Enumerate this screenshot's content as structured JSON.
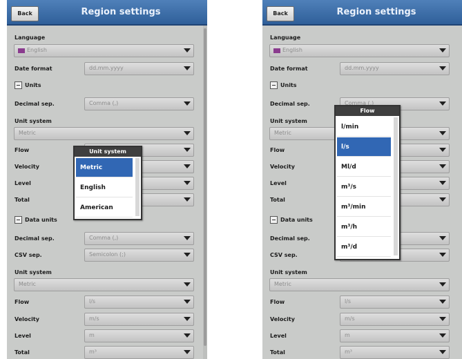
{
  "left": {
    "header": {
      "back_label": "Back",
      "title": "Region settings"
    },
    "language": {
      "label": "Language",
      "value": "English"
    },
    "date_format": {
      "label": "Date format",
      "value": "dd.mm.yyyy"
    },
    "units": {
      "title": "Units",
      "decimal_sep": {
        "label": "Decimal sep.",
        "value": "Comma (,)"
      },
      "unit_system": {
        "label": "Unit system",
        "value": "Metric"
      },
      "flow": {
        "label": "Flow",
        "value": ""
      },
      "velocity": {
        "label": "Velocity",
        "value": ""
      },
      "level": {
        "label": "Level",
        "value": ""
      },
      "total": {
        "label": "Total",
        "value": ""
      }
    },
    "data_units": {
      "title": "Data units",
      "decimal_sep": {
        "label": "Decimal sep.",
        "value": "Comma (,)"
      },
      "csv_sep": {
        "label": "CSV sep.",
        "value": "Semicolon (;)"
      },
      "unit_system": {
        "label": "Unit system",
        "value": "Metric"
      },
      "flow": {
        "label": "Flow",
        "value": "l/s"
      },
      "velocity": {
        "label": "Velocity",
        "value": "m/s"
      },
      "level": {
        "label": "Level",
        "value": "m"
      },
      "total": {
        "label": "Total",
        "value": "m³"
      }
    },
    "popup": {
      "title": "Unit system",
      "options": [
        "Metric",
        "English",
        "American"
      ],
      "selected": "Metric"
    }
  },
  "right": {
    "header": {
      "back_label": "Back",
      "title": "Region settings"
    },
    "language": {
      "label": "Language",
      "value": "English"
    },
    "date_format": {
      "label": "Date format",
      "value": "dd.mm.yyyy"
    },
    "units": {
      "title": "Units",
      "decimal_sep": {
        "label": "Decimal sep.",
        "value": "Comma (,)"
      },
      "unit_system": {
        "label": "Unit system",
        "value": "Metric"
      },
      "flow": {
        "label": "Flow",
        "value": ""
      },
      "velocity": {
        "label": "Velocity",
        "value": ""
      },
      "level": {
        "label": "Level",
        "value": ""
      },
      "total": {
        "label": "Total",
        "value": ""
      }
    },
    "data_units": {
      "title": "Data units",
      "decimal_sep": {
        "label": "Decimal sep.",
        "value": ""
      },
      "csv_sep": {
        "label": "CSV sep.",
        "value": ""
      },
      "unit_system": {
        "label": "Unit system",
        "value": "Metric"
      },
      "flow": {
        "label": "Flow",
        "value": "l/s"
      },
      "velocity": {
        "label": "Velocity",
        "value": "m/s"
      },
      "level": {
        "label": "Level",
        "value": "m"
      },
      "total": {
        "label": "Total",
        "value": "m³"
      }
    },
    "popup": {
      "title": "Flow",
      "options": [
        "l/min",
        "l/s",
        "Ml/d",
        "m³/s",
        "m³/min",
        "m³/h",
        "m³/d"
      ],
      "selected": "l/s"
    }
  },
  "colors": {
    "header": "#3a6aa6",
    "background": "#c9cbc9",
    "selected": "#3167b4",
    "flag": "#8a3b8e"
  },
  "icons": [
    "collapse-icon",
    "flag-icon",
    "dropdown-arrow-icon"
  ]
}
